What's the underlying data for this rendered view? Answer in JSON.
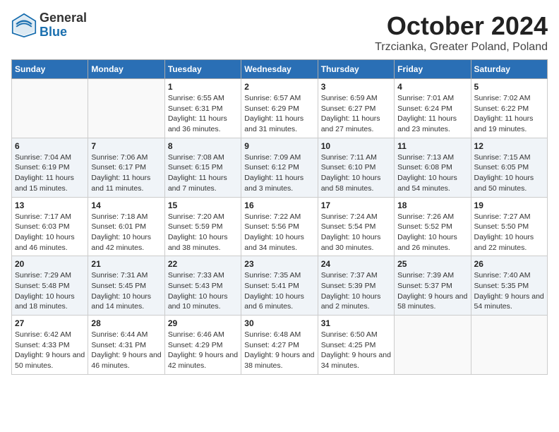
{
  "header": {
    "logo_general": "General",
    "logo_blue": "Blue",
    "month_title": "October 2024",
    "location": "Trzcianka, Greater Poland, Poland"
  },
  "days_of_week": [
    "Sunday",
    "Monday",
    "Tuesday",
    "Wednesday",
    "Thursday",
    "Friday",
    "Saturday"
  ],
  "weeks": [
    [
      {
        "day": "",
        "detail": ""
      },
      {
        "day": "",
        "detail": ""
      },
      {
        "day": "1",
        "detail": "Sunrise: 6:55 AM\nSunset: 6:31 PM\nDaylight: 11 hours and 36 minutes."
      },
      {
        "day": "2",
        "detail": "Sunrise: 6:57 AM\nSunset: 6:29 PM\nDaylight: 11 hours and 31 minutes."
      },
      {
        "day": "3",
        "detail": "Sunrise: 6:59 AM\nSunset: 6:27 PM\nDaylight: 11 hours and 27 minutes."
      },
      {
        "day": "4",
        "detail": "Sunrise: 7:01 AM\nSunset: 6:24 PM\nDaylight: 11 hours and 23 minutes."
      },
      {
        "day": "5",
        "detail": "Sunrise: 7:02 AM\nSunset: 6:22 PM\nDaylight: 11 hours and 19 minutes."
      }
    ],
    [
      {
        "day": "6",
        "detail": "Sunrise: 7:04 AM\nSunset: 6:19 PM\nDaylight: 11 hours and 15 minutes."
      },
      {
        "day": "7",
        "detail": "Sunrise: 7:06 AM\nSunset: 6:17 PM\nDaylight: 11 hours and 11 minutes."
      },
      {
        "day": "8",
        "detail": "Sunrise: 7:08 AM\nSunset: 6:15 PM\nDaylight: 11 hours and 7 minutes."
      },
      {
        "day": "9",
        "detail": "Sunrise: 7:09 AM\nSunset: 6:12 PM\nDaylight: 11 hours and 3 minutes."
      },
      {
        "day": "10",
        "detail": "Sunrise: 7:11 AM\nSunset: 6:10 PM\nDaylight: 10 hours and 58 minutes."
      },
      {
        "day": "11",
        "detail": "Sunrise: 7:13 AM\nSunset: 6:08 PM\nDaylight: 10 hours and 54 minutes."
      },
      {
        "day": "12",
        "detail": "Sunrise: 7:15 AM\nSunset: 6:05 PM\nDaylight: 10 hours and 50 minutes."
      }
    ],
    [
      {
        "day": "13",
        "detail": "Sunrise: 7:17 AM\nSunset: 6:03 PM\nDaylight: 10 hours and 46 minutes."
      },
      {
        "day": "14",
        "detail": "Sunrise: 7:18 AM\nSunset: 6:01 PM\nDaylight: 10 hours and 42 minutes."
      },
      {
        "day": "15",
        "detail": "Sunrise: 7:20 AM\nSunset: 5:59 PM\nDaylight: 10 hours and 38 minutes."
      },
      {
        "day": "16",
        "detail": "Sunrise: 7:22 AM\nSunset: 5:56 PM\nDaylight: 10 hours and 34 minutes."
      },
      {
        "day": "17",
        "detail": "Sunrise: 7:24 AM\nSunset: 5:54 PM\nDaylight: 10 hours and 30 minutes."
      },
      {
        "day": "18",
        "detail": "Sunrise: 7:26 AM\nSunset: 5:52 PM\nDaylight: 10 hours and 26 minutes."
      },
      {
        "day": "19",
        "detail": "Sunrise: 7:27 AM\nSunset: 5:50 PM\nDaylight: 10 hours and 22 minutes."
      }
    ],
    [
      {
        "day": "20",
        "detail": "Sunrise: 7:29 AM\nSunset: 5:48 PM\nDaylight: 10 hours and 18 minutes."
      },
      {
        "day": "21",
        "detail": "Sunrise: 7:31 AM\nSunset: 5:45 PM\nDaylight: 10 hours and 14 minutes."
      },
      {
        "day": "22",
        "detail": "Sunrise: 7:33 AM\nSunset: 5:43 PM\nDaylight: 10 hours and 10 minutes."
      },
      {
        "day": "23",
        "detail": "Sunrise: 7:35 AM\nSunset: 5:41 PM\nDaylight: 10 hours and 6 minutes."
      },
      {
        "day": "24",
        "detail": "Sunrise: 7:37 AM\nSunset: 5:39 PM\nDaylight: 10 hours and 2 minutes."
      },
      {
        "day": "25",
        "detail": "Sunrise: 7:39 AM\nSunset: 5:37 PM\nDaylight: 9 hours and 58 minutes."
      },
      {
        "day": "26",
        "detail": "Sunrise: 7:40 AM\nSunset: 5:35 PM\nDaylight: 9 hours and 54 minutes."
      }
    ],
    [
      {
        "day": "27",
        "detail": "Sunrise: 6:42 AM\nSunset: 4:33 PM\nDaylight: 9 hours and 50 minutes."
      },
      {
        "day": "28",
        "detail": "Sunrise: 6:44 AM\nSunset: 4:31 PM\nDaylight: 9 hours and 46 minutes."
      },
      {
        "day": "29",
        "detail": "Sunrise: 6:46 AM\nSunset: 4:29 PM\nDaylight: 9 hours and 42 minutes."
      },
      {
        "day": "30",
        "detail": "Sunrise: 6:48 AM\nSunset: 4:27 PM\nDaylight: 9 hours and 38 minutes."
      },
      {
        "day": "31",
        "detail": "Sunrise: 6:50 AM\nSunset: 4:25 PM\nDaylight: 9 hours and 34 minutes."
      },
      {
        "day": "",
        "detail": ""
      },
      {
        "day": "",
        "detail": ""
      }
    ]
  ]
}
